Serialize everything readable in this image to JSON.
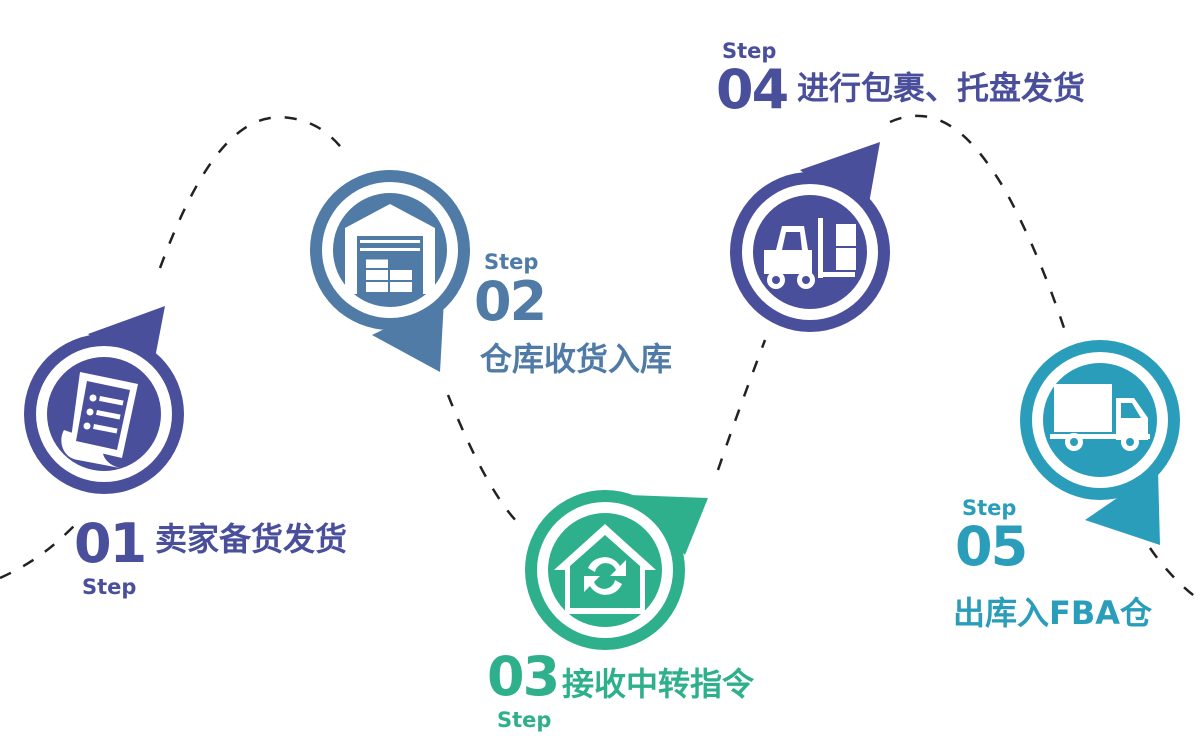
{
  "steps": [
    {
      "word": "Step",
      "number": "01",
      "label": "卖家备货发货",
      "icon": "document-list-icon",
      "color": "#4a4f9c"
    },
    {
      "word": "Step",
      "number": "02",
      "label": "仓库收货入库",
      "icon": "warehouse-icon",
      "color": "#4f7ba6"
    },
    {
      "word": "Step",
      "number": "03",
      "label": "接收中转指令",
      "icon": "transfer-home-icon",
      "color": "#2fb08d"
    },
    {
      "word": "Step",
      "number": "04",
      "label": "进行包裹、托盘发货",
      "icon": "forklift-icon",
      "color": "#4a4f9c"
    },
    {
      "word": "Step",
      "number": "05",
      "label": "出库入FBA仓",
      "icon": "truck-icon",
      "color": "#2a9dbb"
    }
  ]
}
